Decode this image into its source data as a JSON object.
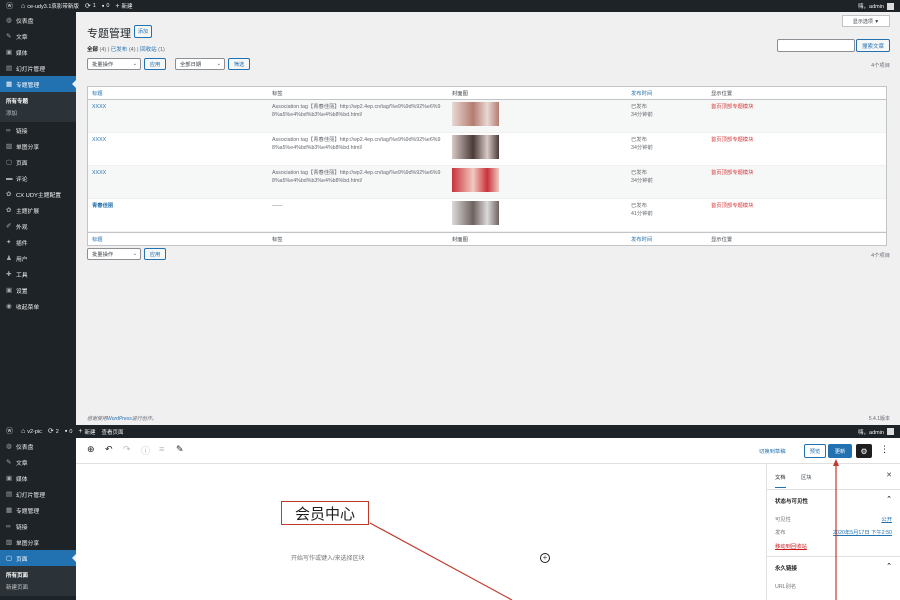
{
  "top": {
    "adminbar": {
      "site_name": "ce-udy3.1哀影带新版",
      "comments_count": "1",
      "bubble_count": "0",
      "new_label": "新建",
      "howdy": "嗨，admin"
    },
    "sidebar": [
      {
        "icon": "dashboard-icon",
        "glyph": "◍",
        "label": "仪表盘"
      },
      {
        "icon": "pin-icon",
        "glyph": "✎",
        "label": "文章"
      },
      {
        "icon": "media-icon",
        "glyph": "▣",
        "label": "媒体"
      },
      {
        "icon": "slides-icon",
        "glyph": "▤",
        "label": "幻灯片管理"
      },
      {
        "icon": "topics-icon",
        "glyph": "▦",
        "label": "专题管理",
        "active": true
      },
      {
        "icon": "links-icon",
        "glyph": "∞",
        "label": "链接"
      },
      {
        "icon": "gallery-icon",
        "glyph": "▨",
        "label": "单图分享"
      },
      {
        "icon": "pages-icon",
        "glyph": "▢",
        "label": "页面"
      },
      {
        "icon": "comments-icon",
        "glyph": "▬",
        "label": "评论"
      },
      {
        "icon": "theme-settings-icon",
        "glyph": "✿",
        "label": "CX UDY主题配置"
      },
      {
        "icon": "extend-icon",
        "glyph": "✿",
        "label": "主题扩展"
      },
      {
        "icon": "appearance-icon",
        "glyph": "✐",
        "label": "外观"
      },
      {
        "icon": "plugins-icon",
        "glyph": "✦",
        "label": "插件"
      },
      {
        "icon": "users-icon",
        "glyph": "♟",
        "label": "用户"
      },
      {
        "icon": "tools-icon",
        "glyph": "✚",
        "label": "工具"
      },
      {
        "icon": "settings-icon",
        "glyph": "▣",
        "label": "设置"
      },
      {
        "icon": "collapse-icon",
        "glyph": "◉",
        "label": "收起菜单"
      }
    ],
    "submenu": [
      "所有专题",
      "添加"
    ],
    "screen_options": "显示选项 ▼",
    "title": "专题管理",
    "add_new": "添加",
    "filters": {
      "all": "全部",
      "all_count": "(4)",
      "published": "已发布",
      "published_count": "(4)",
      "trash": "回收站",
      "trash_count": "(1)"
    },
    "search_button": "搜索文章",
    "bulk_action": "批量操作",
    "apply": "应用",
    "all_dates": "全部日期",
    "filter": "筛选",
    "items_count": "4个项目",
    "columns": [
      "标题",
      "标签",
      "封面图",
      "发布时间",
      "显示位置"
    ],
    "rows": [
      {
        "title": "XXXX",
        "tag": "Association tag【青春佳丽】http://wp2.4ep.cn/tag/%e9%9d%92%e6%98%a5%e4%bd%b3%e4%b8%bd.html/",
        "status": "已发布",
        "time": "34分钟前",
        "position": "首页顶部专题模块",
        "colors": [
          "#e9d8d4",
          "#b47c70"
        ]
      },
      {
        "title": "XXXX",
        "tag": "Association tag【青春佳丽】http://wp2.4ep.cn/tag/%e9%9d%92%e6%98%a5%e4%bd%b3%e4%b8%bd.html/",
        "status": "已发布",
        "time": "34分钟前",
        "position": "首页顶部专题模块",
        "colors": [
          "#d9c9c6",
          "#4a3a38"
        ]
      },
      {
        "title": "XXXX",
        "tag": "Association tag【青春佳丽】http://wp2.4ep.cn/tag/%e9%9d%92%e6%98%a5%e4%bd%b3%e4%b8%bd.html/",
        "status": "已发布",
        "time": "34分钟前",
        "position": "首页顶部专题模块",
        "colors": [
          "#c8323a",
          "#f2c9c0"
        ]
      },
      {
        "title": "青春佳丽",
        "tag": "——",
        "status": "已发布",
        "time": "41分钟前",
        "position": "首页顶部专题模块",
        "colors": [
          "#dcdada",
          "#6e625e"
        ]
      }
    ],
    "footer_pre": "感谢使用",
    "footer_link": "WordPress",
    "footer_post": "进行创作。",
    "version": "5.4.1版本"
  },
  "bottom": {
    "adminbar": {
      "site_name": "v2-pic",
      "updates": "2",
      "bubble_count": "0",
      "new_label": "新建",
      "view_page": "查看页面",
      "howdy": "嗨，admin"
    },
    "sidebar": [
      {
        "icon": "dashboard-icon",
        "glyph": "◍",
        "label": "仪表盘"
      },
      {
        "icon": "pin-icon",
        "glyph": "✎",
        "label": "文章"
      },
      {
        "icon": "media-icon",
        "glyph": "▣",
        "label": "媒体"
      },
      {
        "icon": "slides-icon",
        "glyph": "▤",
        "label": "幻灯片管理"
      },
      {
        "icon": "topics-icon",
        "glyph": "▦",
        "label": "专题管理"
      },
      {
        "icon": "links-icon",
        "glyph": "∞",
        "label": "链接"
      },
      {
        "icon": "gallery-icon",
        "glyph": "▨",
        "label": "单图分享"
      },
      {
        "icon": "pages-icon",
        "glyph": "▢",
        "label": "页面",
        "active": true
      }
    ],
    "submenu": [
      "所有页面",
      "新建页面"
    ],
    "switch_draft": "切换到草稿",
    "preview": "预览",
    "publish": "更新",
    "page_title": "会员中心",
    "placeholder": "开始写作或键入/来选择区块",
    "panel": {
      "tab_doc": "文档",
      "tab_block": "区块",
      "status_title": "状态与可见性",
      "visibility_label": "可见性",
      "visibility_value": "公开",
      "publish_label": "发布",
      "publish_value": "2020年5月17日 下午2:50",
      "trash": "移动到回收站",
      "permalink_title": "永久链接",
      "url_alias": "URL别名"
    }
  }
}
